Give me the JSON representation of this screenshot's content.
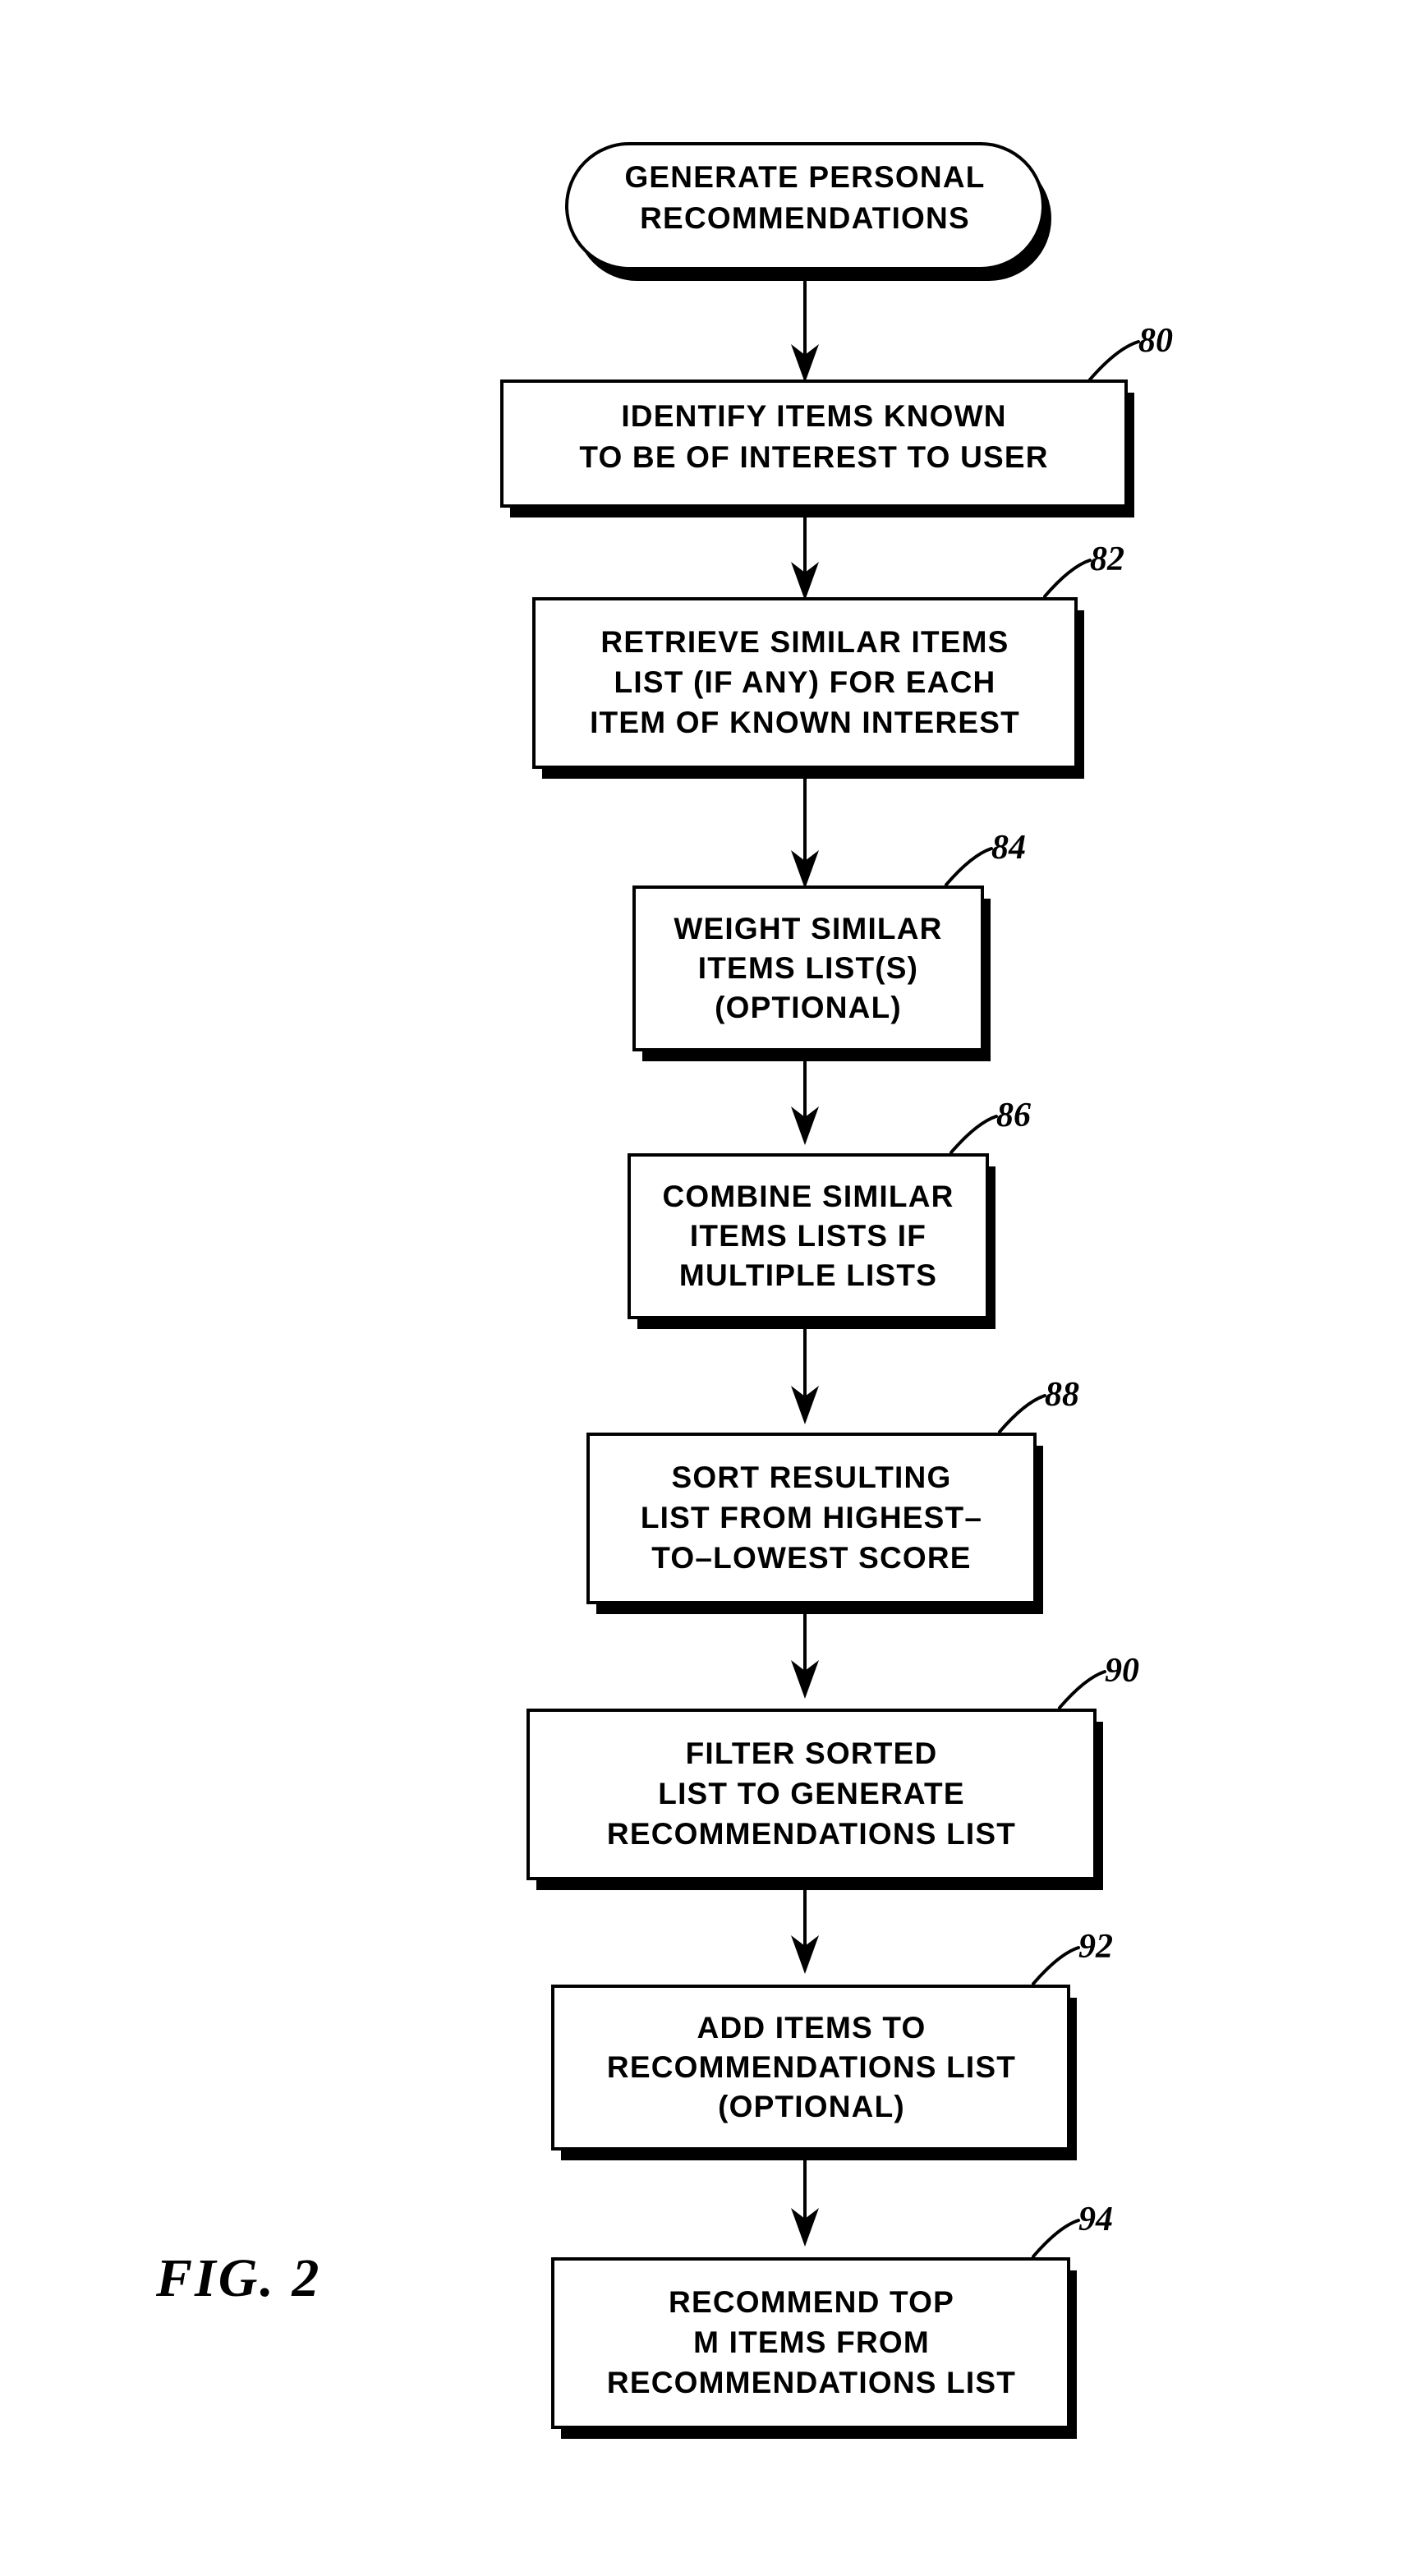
{
  "figure": {
    "label": "FIG. 2",
    "title_node": {
      "ref": "",
      "lines": [
        "GENERATE PERSONAL",
        "RECOMMENDATIONS"
      ]
    },
    "steps": [
      {
        "ref": "80",
        "lines": [
          "IDENTIFY ITEMS KNOWN",
          "TO BE OF INTEREST TO USER"
        ]
      },
      {
        "ref": "82",
        "lines": [
          "RETRIEVE SIMILAR ITEMS",
          "LIST (IF ANY) FOR EACH",
          "ITEM OF KNOWN INTEREST"
        ]
      },
      {
        "ref": "84",
        "lines": [
          "WEIGHT SIMILAR",
          "ITEMS LIST(S)",
          "(OPTIONAL)"
        ]
      },
      {
        "ref": "86",
        "lines": [
          "COMBINE SIMILAR",
          "ITEMS LISTS IF",
          "MULTIPLE LISTS"
        ]
      },
      {
        "ref": "88",
        "lines": [
          "SORT RESULTING",
          "LIST FROM HIGHEST–",
          "TO–LOWEST SCORE"
        ]
      },
      {
        "ref": "90",
        "lines": [
          "FILTER SORTED",
          "LIST TO GENERATE",
          "RECOMMENDATIONS LIST"
        ]
      },
      {
        "ref": "92",
        "lines": [
          "ADD ITEMS TO",
          "RECOMMENDATIONS LIST",
          "(OPTIONAL)"
        ]
      },
      {
        "ref": "94",
        "lines": [
          "RECOMMEND TOP",
          "M ITEMS FROM",
          "RECOMMENDATIONS LIST"
        ]
      }
    ],
    "colors": {
      "ink": "#000000",
      "paper": "#ffffff"
    }
  }
}
